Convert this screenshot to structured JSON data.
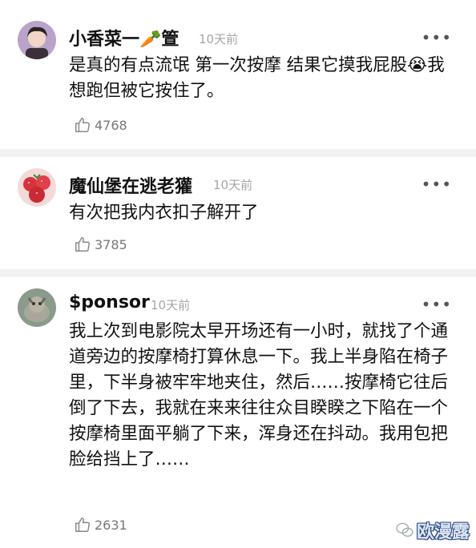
{
  "comments": [
    {
      "username": "小香菜一🥕箮",
      "time": "10天前",
      "text": "是真的有点流氓 第一次按摩 结果它摸我屁股😭我想跑但被它按住了。",
      "likes": "4768",
      "more_label": "•••"
    },
    {
      "username": "魔仙堡在逃老獾",
      "time": "10天前",
      "text": "有次把我内衣扣子解开了",
      "likes": "3785",
      "more_label": "•••"
    },
    {
      "username": "$ponsor",
      "time": "10天前",
      "text": "我上次到电影院太早开场还有一小时，就找了个通道旁边的按摩椅打算休息一下。我上半身陷在椅子里，下半身被牢牢地夹住，然后……按摩椅它往后倒了下去，我就在来来往往众目睽睽之下陷在一个按摩椅里面平躺了下来，浑身还在抖动。我用包把脸给挡上了……",
      "likes": "2631",
      "more_label": "•••"
    }
  ],
  "watermark": "欧漫露"
}
